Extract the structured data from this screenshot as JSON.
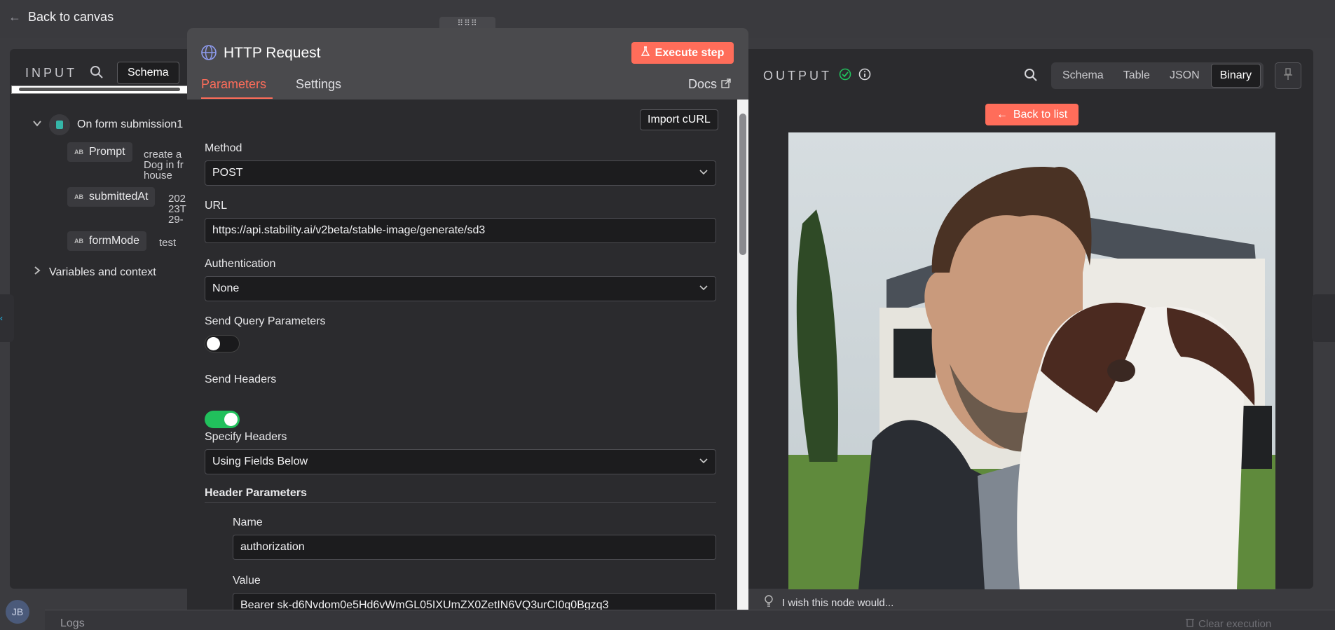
{
  "topbar": {
    "back_label": "Back to canvas"
  },
  "input": {
    "title": "INPUT",
    "tab_schema": "Schema",
    "node_name": "On form submission1",
    "fields": [
      {
        "type": "AB",
        "name": "Prompt",
        "value_lines": [
          "create a",
          "Dog in fr",
          "house"
        ]
      },
      {
        "type": "AB",
        "name": "submittedAt",
        "value_lines": [
          "202",
          "23T",
          "29-"
        ]
      },
      {
        "type": "AB",
        "name": "formMode",
        "value_lines": [
          "test"
        ]
      }
    ],
    "variables_label": "Variables and context"
  },
  "node": {
    "title": "HTTP Request",
    "execute_label": "Execute step",
    "tabs": {
      "parameters": "Parameters",
      "settings": "Settings",
      "docs": "Docs"
    },
    "import_curl": "Import cURL",
    "method": {
      "label": "Method",
      "value": "POST"
    },
    "url": {
      "label": "URL",
      "value": "https://api.stability.ai/v2beta/stable-image/generate/sd3"
    },
    "authentication": {
      "label": "Authentication",
      "value": "None"
    },
    "send_query": {
      "label": "Send Query Parameters",
      "enabled": false
    },
    "send_headers": {
      "label": "Send Headers",
      "enabled": true
    },
    "specify_headers": {
      "label": "Specify Headers",
      "value": "Using Fields Below"
    },
    "header_params": {
      "label": "Header Parameters",
      "name_label": "Name",
      "name_value": "authorization",
      "value_label": "Value",
      "value_value": "Bearer sk-d6Nvdom0e5Hd6vWmGL05IXUmZX0ZetIN6VQ3urCI0q0Bgzq3"
    }
  },
  "output": {
    "title": "OUTPUT",
    "tabs": [
      "Schema",
      "Table",
      "JSON",
      "Binary"
    ],
    "active_tab": "Binary",
    "back_to_list": "Back to list",
    "feedback": "I wish this node would..."
  },
  "bottom": {
    "avatar_initials": "JB",
    "logs": "Logs",
    "clear_execution": "Clear execution"
  },
  "colors": {
    "accent": "#ff6d5a",
    "toggle_on": "#21c05c",
    "success": "#21c05c"
  }
}
